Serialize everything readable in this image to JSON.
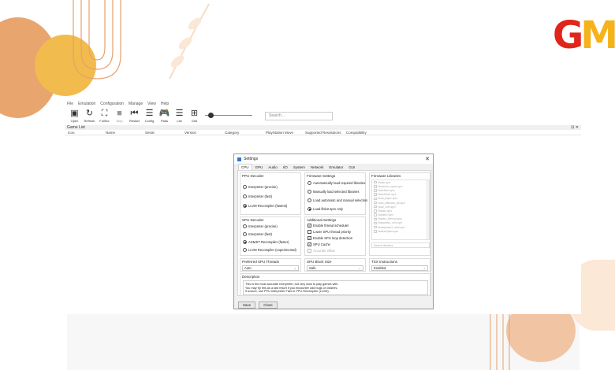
{
  "logo": {
    "g": "G",
    "m": "M"
  },
  "menu": [
    "File",
    "Emulation",
    "Configuration",
    "Manage",
    "View",
    "Help"
  ],
  "toolbar": [
    {
      "label": "Open",
      "icon": "folder-icon",
      "glyph": "▣",
      "enabled": true
    },
    {
      "label": "Refresh",
      "icon": "refresh-icon",
      "glyph": "↻",
      "enabled": true
    },
    {
      "label": "FullScr",
      "icon": "fullscreen-icon",
      "glyph": "⛶",
      "enabled": true
    },
    {
      "label": "Stop",
      "icon": "stop-icon",
      "glyph": "■",
      "enabled": false
    },
    {
      "label": "Restart",
      "icon": "restart-icon",
      "glyph": "⏮",
      "enabled": true
    },
    {
      "label": "Config",
      "icon": "config-icon",
      "glyph": "☰",
      "enabled": true
    },
    {
      "label": "Pads",
      "icon": "gamepad-icon",
      "glyph": "🎮",
      "enabled": true
    },
    {
      "label": "List",
      "icon": "list-icon",
      "glyph": "☰",
      "enabled": true
    },
    {
      "label": "Grid",
      "icon": "grid-icon",
      "glyph": "⊞",
      "enabled": true
    }
  ],
  "search": {
    "placeholder": "Search..."
  },
  "gamelist": {
    "title": "Game List",
    "controls": "⊡ ✕"
  },
  "columns": [
    "Icon",
    "Name",
    "Serial",
    "Version",
    "Category",
    "PlayStation Move",
    "Supported Resolutions",
    "Compatibility"
  ],
  "dialog": {
    "title": "Settings",
    "close": "✕",
    "tabs": [
      "CPU",
      "GPU",
      "Audio",
      "I/O",
      "System",
      "Network",
      "Emulator",
      "GUI"
    ],
    "active_tab": "CPU",
    "ppu_decoder": {
      "title": "PPU Decoder",
      "options": [
        "Interpreter (precise)",
        "Interpreter (fast)",
        "LLVM Recompiler (fastest)"
      ],
      "selected": 2
    },
    "spu_decoder": {
      "title": "SPU Decoder",
      "options": [
        "Interpreter (precise)",
        "Interpreter (fast)",
        "ASMJIT Recompiler (faster)",
        "LLVM Recompiler (experimental)"
      ],
      "selected": 2
    },
    "firmware_settings": {
      "title": "Firmware Settings",
      "options": [
        "Automatically load required libraries",
        "Manually load selected libraries",
        "Load automatic and manual selection",
        "Load liblv2.sprx only"
      ],
      "selected": 3
    },
    "additional_settings": {
      "title": "Additional Settings",
      "options": [
        {
          "label": "Enable thread scheduler",
          "checked": true,
          "enabled": true
        },
        {
          "label": "Lower SPU thread priority",
          "checked": false,
          "enabled": true
        },
        {
          "label": "Enable SPU loop detection",
          "checked": true,
          "enabled": true
        },
        {
          "label": "SPU Cache",
          "checked": true,
          "enabled": true
        },
        {
          "label": "Accurate xfloat",
          "checked": false,
          "enabled": false
        }
      ]
    },
    "firmware_libraries": {
      "title": "Firmware Libraries",
      "items": [
        "libaac.sprx",
        "libaacenc_spurs.sprx",
        "libac3dec.sprx",
        "libac3dec2.sprx",
        "libad_async.sprx",
        "libad_billboard_util.sprx",
        "libad_core.sprx",
        "libadec.sprx",
        "libadec2.sprx",
        "libadec_internal.sprx",
        "libapostsrc_mini.sprx",
        "libasfparser2_astd.sprx",
        "libatrac3plus.sprx"
      ],
      "search_placeholder": "Search libraries"
    },
    "preferred_spu_threads": {
      "title": "Preferred SPU Threads",
      "value": "Auto"
    },
    "spu_block_size": {
      "title": "SPU Block Size",
      "value": "Safe"
    },
    "tsx_instructions": {
      "title": "TSX Instructions",
      "value": "Enabled"
    },
    "description": {
      "title": "Description",
      "lines": [
        "This is the most accurate Interpreter, but very slow to play games with.",
        "You may try this as a last resort if you encounter odd bugs or crashes.",
        "If unsure, use PPU Interpreter Fast or PPU Recompiler (LLVM)."
      ]
    },
    "buttons": {
      "save": "Save",
      "close": "Close"
    }
  }
}
